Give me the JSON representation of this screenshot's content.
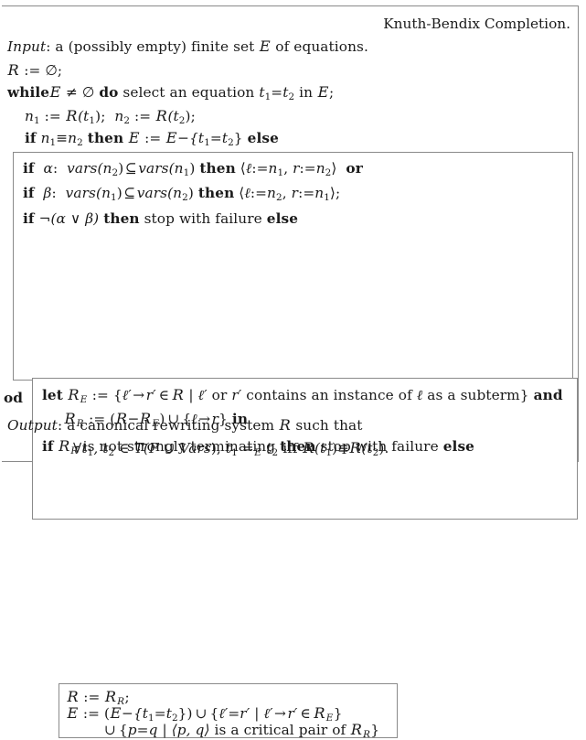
{
  "figure": {
    "kind": "algorithm-pseudocode",
    "title": "Knuth-Bendix Completion.",
    "border_color": "#8a8a8a",
    "text_color": "#1a1a1a"
  },
  "lines": {
    "input_label": "Input",
    "input_colon": ": a (possibly empty) finite set ",
    "input_cal_E": "E",
    "input_tail": " of equations.",
    "l_R": "R",
    "l_assign": " := ",
    "l_emptyset_semi": "∅;",
    "while_kw": "while",
    "while_cal_E": "E",
    "while_neq": " ≠ ",
    "while_emptyset": "∅ ",
    "do_kw": "do",
    "while_mid": " select an equation ",
    "while_t1": "t",
    "while_sub1": "1",
    "while_eq": "=",
    "while_t2": "t",
    "while_sub2": "2",
    "while_in": " in ",
    "while_cal_E2": "E",
    "while_semi": ";",
    "n1_label": "n",
    "n1_sub": "1",
    "n1_assign": " := ",
    "n1_calR": "R",
    "n1_open": "(t",
    "n1_tsub": "1",
    "n1_close": ");",
    "n2_label": "n",
    "n2_sub": "2",
    "n2_assign": " := ",
    "n2_calR": "R",
    "n2_open": "(t",
    "n2_tsub": "2",
    "n2_close": ");",
    "if_kw": "if",
    "if_n1": "n",
    "if_n1sub": "1",
    "if_equiv": "≡",
    "if_n2": "n",
    "if_n2sub": "2",
    "then_kw": "then",
    "if_calE": "E",
    "if_assign": " := ",
    "if_calE2": "E",
    "if_minus": "−",
    "if_set_open": "{t",
    "if_t1sub": "1",
    "if_eq": "=",
    "if_t2": "t",
    "if_t2sub": "2",
    "if_set_close": "}",
    "else_kw": "else",
    "alpha_if": "if",
    "alpha_sym": "α",
    "alpha_colon": ": ",
    "alpha_vars1": "vars",
    "alpha_vars1_arg": "(n",
    "alpha_vars1_sub": "2",
    "alpha_vars1_close": ")",
    "alpha_subseteq": "⊆",
    "alpha_vars2": "vars",
    "alpha_vars2_arg": "(n",
    "alpha_vars2_sub": "1",
    "alpha_vars2_close": ")",
    "alpha_then": "then",
    "alpha_angle_open": "⟨",
    "alpha_ell": "ℓ",
    "alpha_assign1": ":=",
    "alpha_n1": "n",
    "alpha_n1sub": "1",
    "alpha_comma": ", ",
    "alpha_r": "r",
    "alpha_assign2": ":=",
    "alpha_n2": "n",
    "alpha_n2sub": "2",
    "alpha_angle_close": "⟩",
    "alpha_or": "or",
    "beta_if": "if",
    "beta_sym": "β",
    "beta_colon": ": ",
    "beta_vars1": "vars",
    "beta_vars1_arg": "(n",
    "beta_vars1_sub": "1",
    "beta_vars1_close": ")",
    "beta_subseteq": "⊆",
    "beta_vars2": "vars",
    "beta_vars2_arg": "(n",
    "beta_vars2_sub": "2",
    "beta_vars2_close": ")",
    "beta_then": "then",
    "beta_angle_open": "⟨",
    "beta_ell": "ℓ",
    "beta_assign1": ":=",
    "beta_n2": "n",
    "beta_n2sub": "2",
    "beta_comma": ", ",
    "beta_r": "r",
    "beta_assign2": ":=",
    "beta_n1": "n",
    "beta_n1sub": "1",
    "beta_angle_close": "⟩;",
    "neg_if": "if",
    "neg_expr": "¬(α ∨ β)",
    "neg_then": "then",
    "neg_stop": " stop with failure ",
    "neg_else": "else",
    "let_kw": "let",
    "let_calR": "R",
    "let_calR_sub": "E",
    "let_assign": " := ",
    "let_set_open": "{",
    "let_ell_prime": "ℓ′",
    "let_arrow": "→",
    "let_r_prime": "r′",
    "let_in_sym": "∈",
    "let_calR2": "R",
    "let_bar": " | ",
    "let_ell_prime2": "ℓ′",
    "let_or_text": " or ",
    "let_r_prime2": "r′",
    "let_text": " contains an instance of ",
    "let_ell2": "ℓ",
    "let_text2": " as a subterm}",
    "let_and": "and",
    "letR_calR": "R",
    "letR_sub": "R",
    "letR_assign": " := ",
    "letR_open": "(",
    "letR_calR2": "R",
    "letR_minus": "−",
    "letR_calR3": "R",
    "letR_calR3_sub": "E",
    "letR_close": ")",
    "letR_cup": "∪",
    "letR_set_open": "{",
    "letR_ell": "ℓ",
    "letR_arrow": "→",
    "letR_r": "r",
    "letR_set_close": "}",
    "letR_in": "in",
    "term_if": "if",
    "term_calR": "R",
    "term_sub": "R",
    "term_text": " is not strongly terminating ",
    "term_then": "then",
    "term_stop": " stop with failure ",
    "term_else": "else",
    "asg_calR": "R",
    "asg_assign": " := ",
    "asg_calR2": "R",
    "asg_calR2_sub": "R",
    "asg_semi": ";",
    "asgE_calE": "E",
    "asgE_assign": "  := ",
    "asgE_open": "(",
    "asgE_calE2": "E",
    "asgE_minus": "−",
    "asgE_set_open": "{t",
    "asgE_t1sub": "1",
    "asgE_eq": "=",
    "asgE_t2": "t",
    "asgE_t2sub": "2",
    "asgE_set_close": "})",
    "asgE_cup": "∪",
    "asgE_set2_open": "{",
    "asgE_ell_prime": "ℓ′",
    "asgE_eq2": "=",
    "asgE_r_prime": "r′",
    "asgE_bar": " | ",
    "asgE_ell_prime2": "ℓ′",
    "asgE_arrow": "→",
    "asgE_r_prime2": "r′",
    "asgE_in": "∈",
    "asgE_calR": "R",
    "asgE_calR_sub": "E",
    "asgE_set2_close": "}",
    "cp_cup": "∪",
    "cp_set_open": "{",
    "cp_p": "p",
    "cp_eq": "=",
    "cp_q": "q",
    "cp_bar": " | ",
    "cp_angle": "⟨p, q⟩",
    "cp_text": " is a critical pair of ",
    "cp_calR": "R",
    "cp_calR_sub": "R",
    "cp_set_close": "}",
    "od_kw": "od",
    "output_label": "Output",
    "output_text1": ": a canonical rewriting system ",
    "output_calR": "R",
    "output_text2": " such that",
    "out2_forall": "∀t",
    "out2_sub1": "1",
    "out2_comma": ", t",
    "out2_sub2": "2",
    "out2_in": " ∈ ",
    "out2_T": "T",
    "out2_open": "(F ∪ ",
    "out2_vars": "Vars",
    "out2_close": "),  ",
    "out2_t1": "t",
    "out2_t1sub": "1",
    "out2_eq": " =",
    "out2_eqsub": "E",
    "out2_t2": " t",
    "out2_t2sub": "2",
    "out2_iff": " iff ",
    "out2_calR": "R",
    "out2_calRopen": "(t",
    "out2_calRsub": "1",
    "out2_calRclose": ")",
    "out2_equiv": "≡",
    "out2_calR2": "R",
    "out2_calR2open": "(t",
    "out2_calR2sub": "2",
    "out2_calR2close": ").",
    "box_alpha_beta_name": "alpha-beta-block",
    "box_let_name": "let-block",
    "box_assign_name": "assignment-block"
  }
}
